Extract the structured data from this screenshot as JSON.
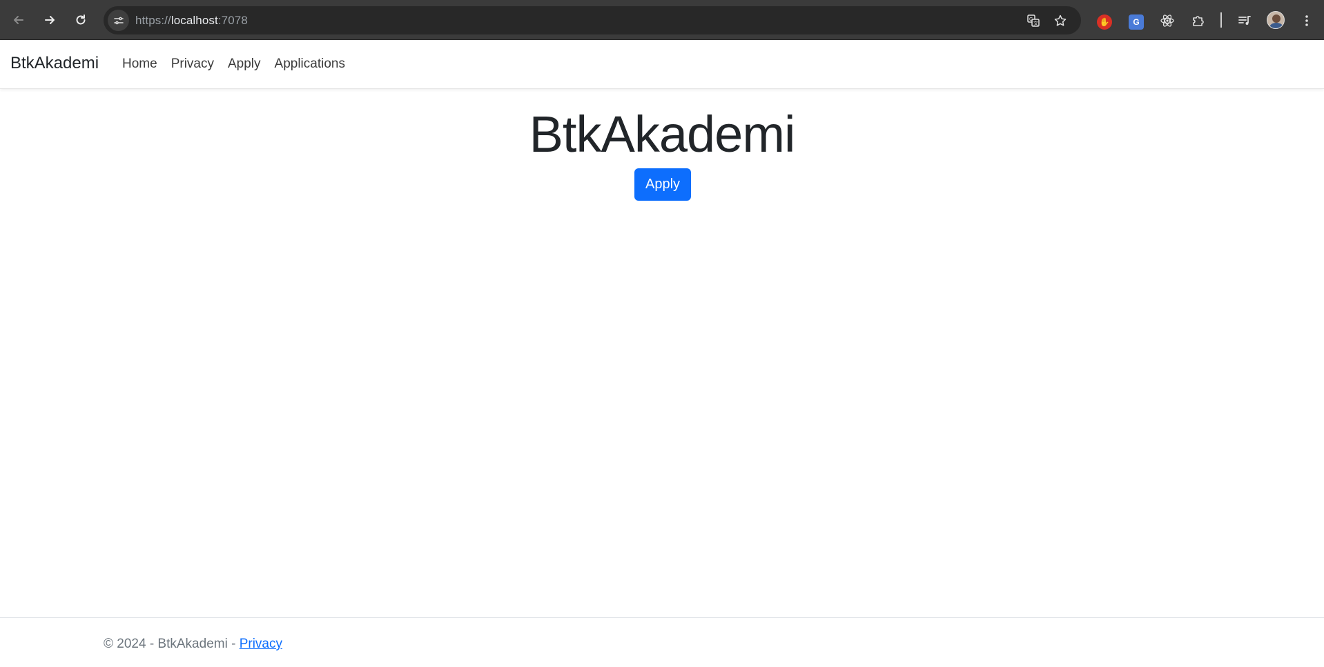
{
  "browser": {
    "url_scheme": "https://",
    "url_host": "localhost",
    "url_port": ":7078",
    "icons": {
      "back": "arrow-left-icon",
      "forward": "arrow-right-icon",
      "reload": "reload-icon",
      "site_info": "tune-icon",
      "translate": "translate-icon",
      "bookmark": "star-icon",
      "extensions": "puzzle-icon",
      "media": "queue-music-icon",
      "menu": "more-vertical-icon"
    }
  },
  "navbar": {
    "brand": "BtkAkademi",
    "links": [
      "Home",
      "Privacy",
      "Apply",
      "Applications"
    ]
  },
  "main": {
    "title": "BtkAkademi",
    "apply_label": "Apply",
    "accent_color": "#0d6efd"
  },
  "footer": {
    "copyright": "© 2024 - BtkAkademi - ",
    "privacy_label": "Privacy"
  }
}
